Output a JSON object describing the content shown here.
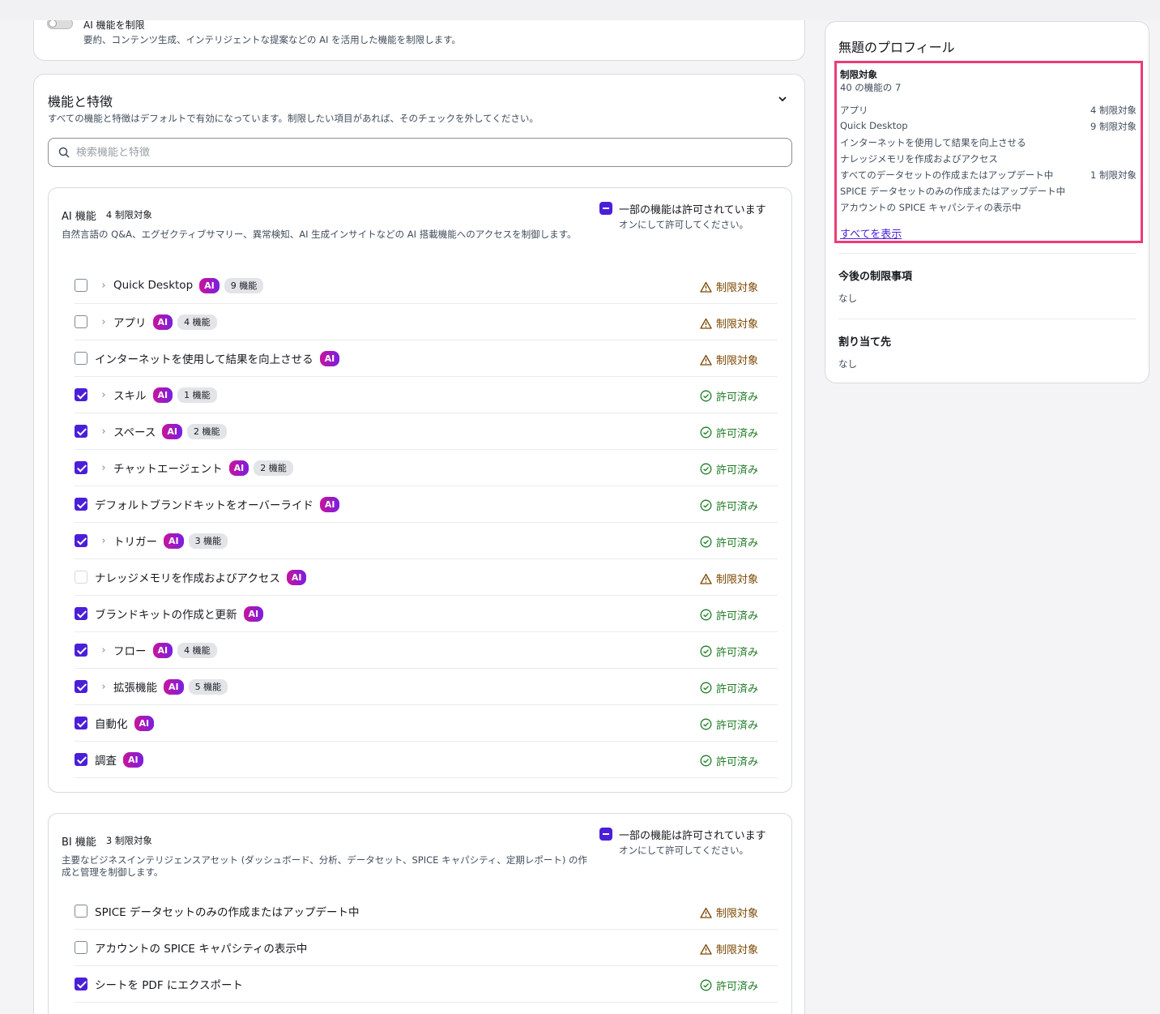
{
  "top_card": {
    "toggle_label": "AI 機能を制限",
    "toggle_desc": "要約、コンテンツ生成、インテリジェントな提案などの AI を活用した機能を制限します。"
  },
  "features": {
    "title": "機能と特徴",
    "desc": "すべての機能と特徴はデフォルトで有効になっています。制限したい項目があれば、そのチェックを外してください。",
    "search_placeholder": "検索機能と特徴"
  },
  "ai_section": {
    "title": "AI 機能",
    "count": "4 制限対象",
    "desc": "自然言語の Q&A、エグゼクティブサマリー、異常検知、AI 生成インサイトなどの AI 搭載機能へのアクセスを制御します。",
    "partial_title": "一部の機能は許可されています",
    "partial_sub": "オンにして許可してください。",
    "rows": [
      {
        "label": "Quick Desktop",
        "ai": "AI",
        "feat": "9 機能",
        "status": "制限対象"
      },
      {
        "label": "アプリ",
        "ai": "AI",
        "feat": "4 機能",
        "status": "制限対象"
      },
      {
        "label": "インターネットを使用して結果を向上させる",
        "ai": "AI",
        "feat": "",
        "status": "制限対象"
      },
      {
        "label": "スキル",
        "ai": "AI",
        "feat": "1 機能",
        "status": "許可済み"
      },
      {
        "label": "スペース",
        "ai": "AI",
        "feat": "2 機能",
        "status": "許可済み"
      },
      {
        "label": "チャットエージェント",
        "ai": "AI",
        "feat": "2 機能",
        "status": "許可済み"
      },
      {
        "label": "デフォルトブランドキットをオーバーライド",
        "ai": "AI",
        "feat": "",
        "status": "許可済み"
      },
      {
        "label": "トリガー",
        "ai": "AI",
        "feat": "3 機能",
        "status": "許可済み"
      },
      {
        "label": "ナレッジメモリを作成およびアクセス",
        "ai": "AI",
        "feat": "",
        "status": "制限対象"
      },
      {
        "label": "ブランドキットの作成と更新",
        "ai": "AI",
        "feat": "",
        "status": "許可済み"
      },
      {
        "label": "フロー",
        "ai": "AI",
        "feat": "4 機能",
        "status": "許可済み"
      },
      {
        "label": "拡張機能",
        "ai": "AI",
        "feat": "5 機能",
        "status": "許可済み"
      },
      {
        "label": "自動化",
        "ai": "AI",
        "feat": "",
        "status": "許可済み"
      },
      {
        "label": "調査",
        "ai": "AI",
        "feat": "",
        "status": "許可済み"
      }
    ]
  },
  "bi_section": {
    "title": "BI 機能",
    "count": "3 制限対象",
    "desc": "主要なビジネスインテリジェンスアセット (ダッシュボード、分析、データセット、SPICE キャパシティ、定期レポート) の作成と管理を制御します。",
    "partial_title": "一部の機能は許可されています",
    "partial_sub": "オンにして許可してください。",
    "rows": [
      {
        "label": "SPICE データセットのみの作成またはアップデート中",
        "status": "制限対象"
      },
      {
        "label": "アカウントの SPICE キャパシティの表示中",
        "status": "制限対象"
      },
      {
        "label": "シートを PDF にエクスポート",
        "status": "許可済み"
      }
    ]
  },
  "sidebar": {
    "title": "無題のプロフィール",
    "restricted_title": "制限対象",
    "restricted_count": "40 の機能の 7",
    "items": [
      {
        "label": "アプリ",
        "value": "4 制限対象"
      },
      {
        "label": "Quick Desktop",
        "value": "9 制限対象"
      },
      {
        "label": "インターネットを使用して結果を向上させる",
        "value": ""
      },
      {
        "label": "ナレッジメモリを作成およびアクセス",
        "value": ""
      },
      {
        "label": "すべてのデータセットの作成またはアップデート中",
        "value": "1 制限対象"
      },
      {
        "label": "SPICE データセットのみの作成またはアップデート中",
        "value": ""
      },
      {
        "label": "アカウントの SPICE キャパシティの表示中",
        "value": ""
      }
    ],
    "show_all": "すべてを表示",
    "future_title": "今後の制限事項",
    "future_value": "なし",
    "assign_title": "割り当て先",
    "assign_value": "なし"
  }
}
